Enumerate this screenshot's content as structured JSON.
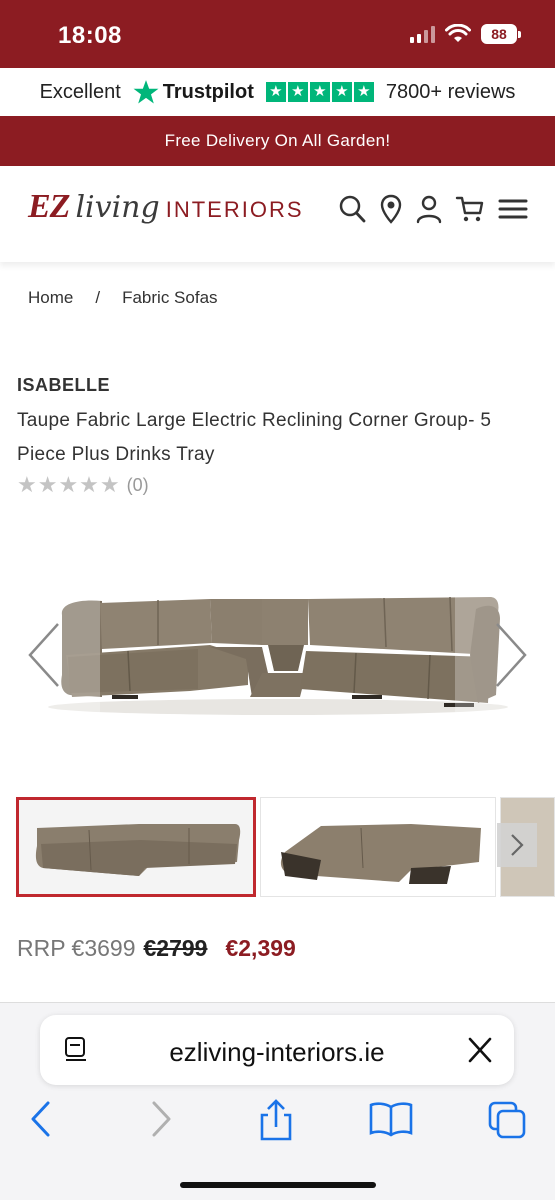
{
  "status_bar": {
    "time": "18:08",
    "battery": "88"
  },
  "trust_bar": {
    "rating_word": "Excellent",
    "brand": "Trustpilot",
    "reviews": "7800+ reviews"
  },
  "promo": {
    "text": "Free Delivery On All Garden!"
  },
  "header": {
    "logo_ez": "EZ",
    "logo_living": "living",
    "logo_interiors": "INTERIORS"
  },
  "breadcrumb": {
    "home": "Home",
    "separator": "/",
    "category": "Fabric Sofas"
  },
  "product": {
    "brand": "ISABELLE",
    "title": "Taupe Fabric Large Electric Reclining Corner Group- 5 Piece Plus Drinks Tray",
    "rating_count": "(0)",
    "rating_value": 0,
    "rating_max": 5,
    "price_rrp": "RRP €3699",
    "price_old": "€2799",
    "price_new": "€2,399"
  },
  "browser": {
    "url": "ezliving-interiors.ie"
  },
  "colors": {
    "brand": "#8c1c22",
    "trustpilot": "#00b67a",
    "sofa": "#8a7d6d"
  }
}
